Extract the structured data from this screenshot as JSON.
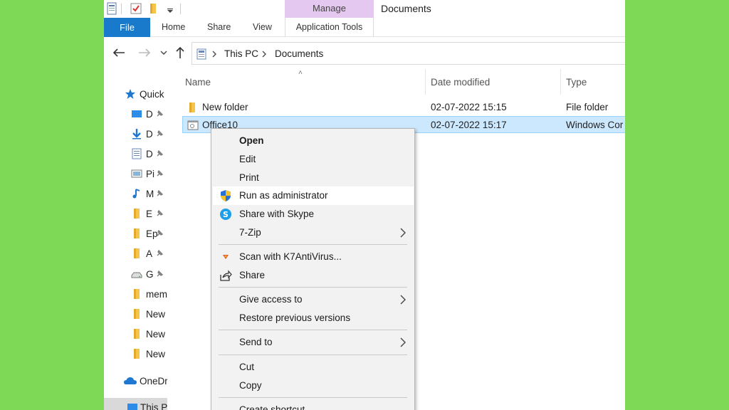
{
  "titlebar": {
    "manage_tab": "Manage",
    "window_title": "Documents"
  },
  "ribbon": {
    "file": "File",
    "home": "Home",
    "share": "Share",
    "view": "View",
    "app_tools": "Application Tools"
  },
  "address": {
    "part1": "This PC",
    "part2": "Documents"
  },
  "navpane": {
    "quick_access": "Quick",
    "items": [
      "D",
      "D",
      "D",
      "Pi",
      "M",
      "E",
      "Ep",
      "A",
      "G",
      "mem",
      "New",
      "New",
      "New"
    ],
    "onedrive": "OneDr",
    "this_pc": "This P"
  },
  "columns": {
    "name": "Name",
    "date": "Date modified",
    "type": "Type"
  },
  "files": [
    {
      "name": "New folder",
      "date": "02-07-2022 15:15",
      "type": "File folder"
    },
    {
      "name": "Office10",
      "date": "02-07-2022 15:17",
      "type": "Windows Cor"
    }
  ],
  "context_menu": {
    "open": "Open",
    "edit": "Edit",
    "print": "Print",
    "run_admin": "Run as administrator",
    "skype": "Share with Skype",
    "zip": "7-Zip",
    "scan": "Scan with K7AntiVirus...",
    "share": "Share",
    "give_access": "Give access to",
    "restore": "Restore previous versions",
    "send_to": "Send to",
    "cut": "Cut",
    "copy": "Copy",
    "create_shortcut": "Create shortcut"
  },
  "colors": {
    "background": "#7ed957",
    "file_tab": "#1979ca",
    "manage_tab": "#e5c8f0",
    "selection": "#cce8ff",
    "folder": "#f4c54a"
  }
}
